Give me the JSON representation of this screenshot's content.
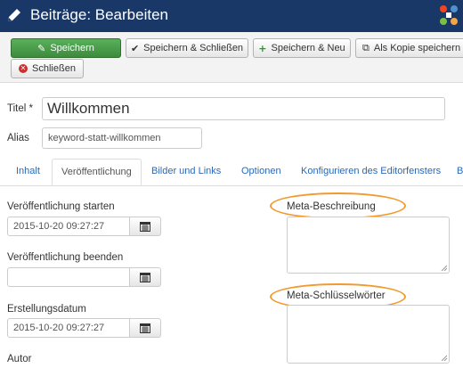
{
  "header": {
    "title": "Beiträge: Bearbeiten",
    "edit_icon": "pencil-icon",
    "logo": "joomla-logo",
    "colors": {
      "header_bg": "#1a3867",
      "save_green": "#46a046",
      "link_blue": "#2a69b8",
      "highlight_oval": "#f29a2e"
    }
  },
  "toolbar": {
    "save": "Speichern",
    "save_close": "Speichern & Schließen",
    "save_new": "Speichern & Neu",
    "save_copy": "Als Kopie speichern",
    "close": "Schließen"
  },
  "form": {
    "title_label": "Titel *",
    "title_value": "Willkommen",
    "alias_label": "Alias",
    "alias_value": "keyword-statt-willkommen"
  },
  "tabs": [
    {
      "label": "Inhalt"
    },
    {
      "label": "Veröffentlichung",
      "active": true
    },
    {
      "label": "Bilder und Links"
    },
    {
      "label": "Optionen"
    },
    {
      "label": "Konfigurieren des Editorfensters"
    },
    {
      "label": "B"
    }
  ],
  "publishing": {
    "start_label": "Veröffentlichung starten",
    "start_value": "2015-10-20 09:27:27",
    "end_label": "Veröffentlichung beenden",
    "end_value": "",
    "created_label": "Erstellungsdatum",
    "created_value": "2015-10-20 09:27:27",
    "author_label": "Autor"
  },
  "meta": {
    "description_label": "Meta-Beschreibung",
    "keywords_label": "Meta-Schlüsselwörter"
  }
}
